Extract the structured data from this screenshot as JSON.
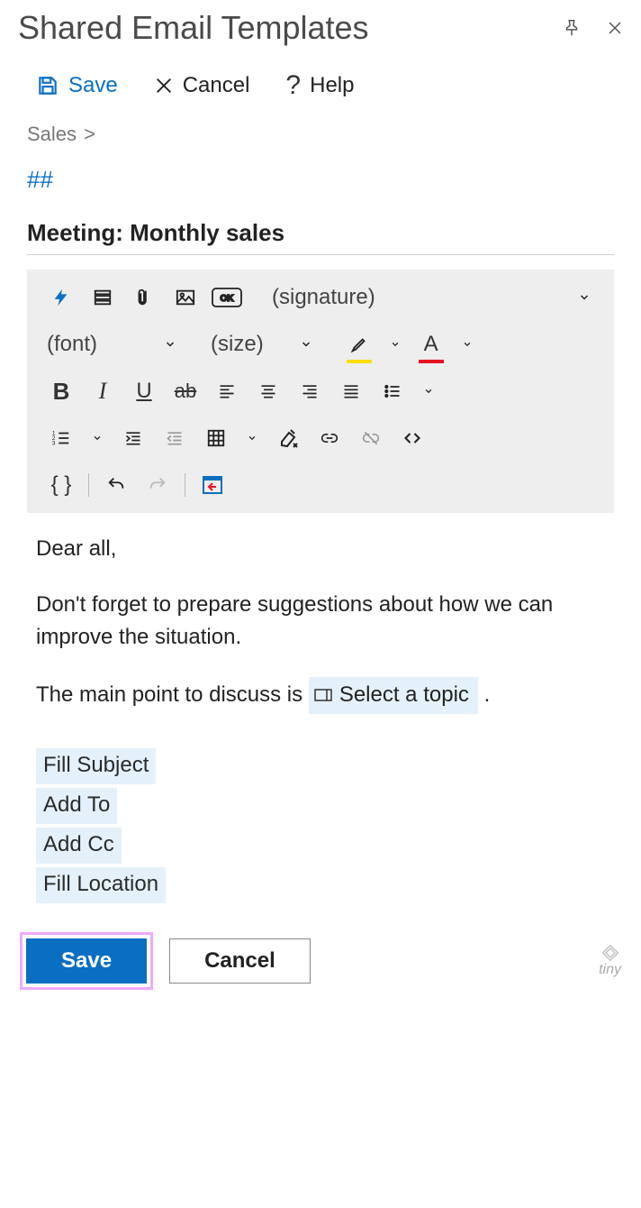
{
  "header": {
    "title": "Shared Email Templates"
  },
  "topbar": {
    "save": "Save",
    "cancel": "Cancel",
    "help": "Help"
  },
  "breadcrumb": {
    "folder": "Sales",
    "sep": ">"
  },
  "hash": "##",
  "subject": "Meeting: Monthly sales",
  "toolbar": {
    "signature": "(signature)",
    "font": "(font)",
    "size": "(size)"
  },
  "body": {
    "greeting": "Dear all,",
    "para1": "Don't forget to prepare suggestions about how we can improve the situation.",
    "para2_pre": "The main point to discuss is ",
    "para2_field": "Select a topic",
    "para2_post": ".",
    "macros": {
      "fill_subject": "Fill Subject",
      "add_to": "Add To",
      "add_cc": "Add Cc",
      "fill_location": "Fill Location"
    }
  },
  "footer": {
    "save": "Save",
    "cancel": "Cancel",
    "tiny": "tiny"
  }
}
